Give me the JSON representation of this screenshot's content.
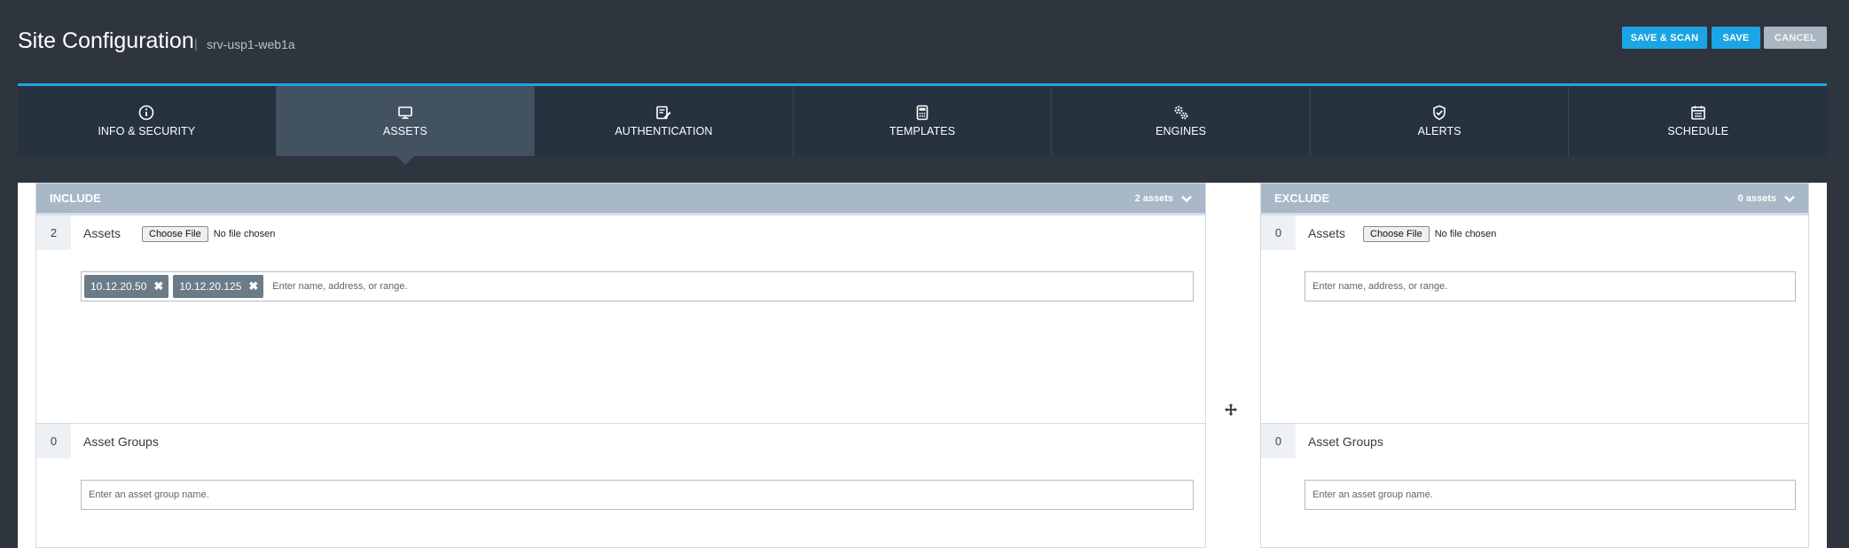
{
  "header": {
    "title": "Site Configuration",
    "separator": "|",
    "subtitle": "srv-usp1-web1a",
    "buttons": {
      "save_scan": "SAVE & SCAN",
      "save": "SAVE",
      "cancel": "CANCEL"
    }
  },
  "colors": {
    "accent": "#1ca5e5",
    "background": "#2e353e",
    "tabbar": "#26323e",
    "tab_active": "#425261",
    "panel_header": "#a8b8c6",
    "tag": "#6a7c88"
  },
  "tabs": [
    {
      "label": "INFO & SECURITY",
      "icon": "info-icon",
      "active": false
    },
    {
      "label": "ASSETS",
      "icon": "monitor-icon",
      "active": true
    },
    {
      "label": "AUTHENTICATION",
      "icon": "edit-document-icon",
      "active": false
    },
    {
      "label": "TEMPLATES",
      "icon": "calculator-icon",
      "active": false
    },
    {
      "label": "ENGINES",
      "icon": "gears-icon",
      "active": false
    },
    {
      "label": "ALERTS",
      "icon": "shield-check-icon",
      "active": false
    },
    {
      "label": "SCHEDULE",
      "icon": "calendar-icon",
      "active": false
    }
  ],
  "include": {
    "title": "INCLUDE",
    "count_label": "2 assets",
    "assets": {
      "count": "2",
      "label": "Assets",
      "file_button": "Choose File",
      "file_status": "No file chosen",
      "tags": [
        "10.12.20.50",
        "10.12.20.125"
      ],
      "placeholder": "Enter name, address, or range."
    },
    "groups": {
      "count": "0",
      "label": "Asset Groups",
      "placeholder": "Enter an asset group name."
    }
  },
  "exclude": {
    "title": "EXCLUDE",
    "count_label": "0 assets",
    "assets": {
      "count": "0",
      "label": "Assets",
      "file_button": "Choose File",
      "file_status": "No file chosen",
      "placeholder": "Enter name, address, or range."
    },
    "groups": {
      "count": "0",
      "label": "Asset Groups",
      "placeholder": "Enter an asset group name."
    }
  }
}
